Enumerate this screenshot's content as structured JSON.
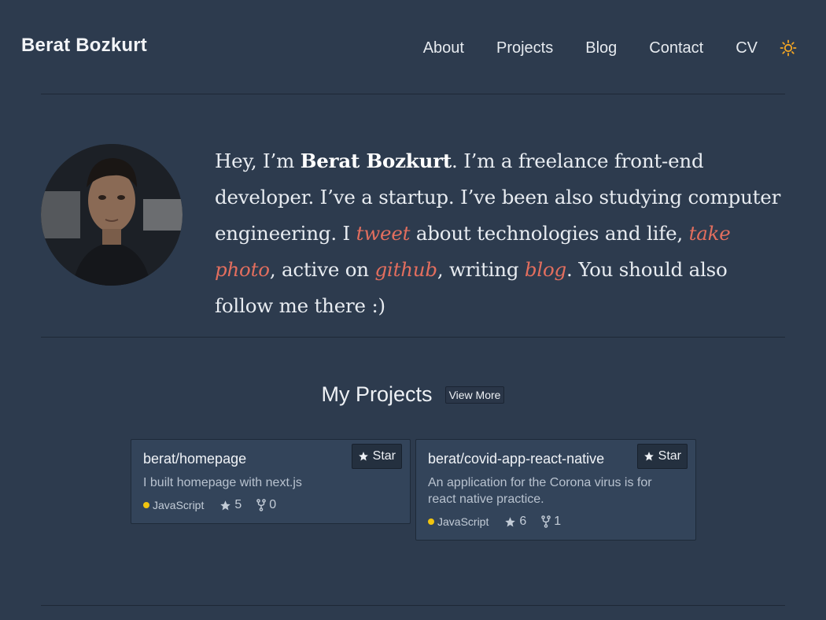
{
  "header": {
    "brand": "Berat Bozkurt",
    "nav": [
      "About",
      "Projects",
      "Blog",
      "Contact",
      "CV"
    ],
    "theme_icon": "sun-icon"
  },
  "intro": {
    "p1": "Hey, I’m ",
    "name": "Berat Bozkurt",
    "p2": ". I’m a freelance front-end developer. I’ve a startup. I’ve been also studying computer engineering. I ",
    "tweet": "tweet",
    "p3": " about technologies and life, ",
    "photo": "take photo",
    "p4": ", active on ",
    "github": "github",
    "p5": ", writing ",
    "blog": "blog",
    "p6": ". You should also follow me there :)"
  },
  "projects": {
    "title": "My Projects",
    "view_more": "View More",
    "items": [
      {
        "repo": "berat/homepage",
        "description": "I built homepage with next.js",
        "language": "JavaScript",
        "stars": "5",
        "forks": "0",
        "star_label": "Star"
      },
      {
        "repo": "berat/covid-app-react-native",
        "description": "An application for the Corona virus is for react native practice.",
        "language": "JavaScript",
        "stars": "6",
        "forks": "1",
        "star_label": "Star"
      }
    ]
  },
  "colors": {
    "background": "#2d3b4e",
    "accent_link": "#e36e5e",
    "card": "#33445a",
    "language_dot": "#f1c40f",
    "sun": "#f5a623"
  }
}
